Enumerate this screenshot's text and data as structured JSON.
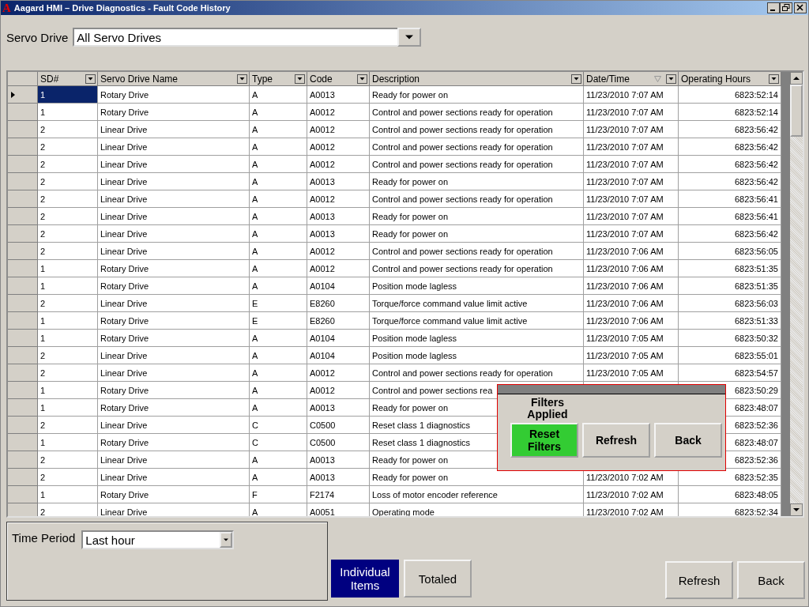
{
  "window": {
    "title": "Aagard HMI – Drive Diagnostics - Fault Code History",
    "logo": "A"
  },
  "servo_drive": {
    "label": "Servo Drive",
    "value": "All Servo Drives"
  },
  "table": {
    "columns": [
      {
        "label": "SD#",
        "sorted": false
      },
      {
        "label": "Servo Drive Name",
        "sorted": false
      },
      {
        "label": "Type",
        "sorted": false
      },
      {
        "label": "Code",
        "sorted": false
      },
      {
        "label": "Description",
        "sorted": false
      },
      {
        "label": "Date/Time",
        "sorted": true
      },
      {
        "label": "Operating Hours",
        "sorted": false
      }
    ],
    "rows": [
      {
        "selected": true,
        "sd": "1",
        "name": "Rotary Drive",
        "type": "A",
        "code": "A0013",
        "description": "Ready for power on",
        "datetime": "11/23/2010 7:07 AM",
        "hours": "6823:52:14"
      },
      {
        "selected": false,
        "sd": "1",
        "name": "Rotary Drive",
        "type": "A",
        "code": "A0012",
        "description": "Control and power sections ready for operation",
        "datetime": "11/23/2010 7:07 AM",
        "hours": "6823:52:14"
      },
      {
        "selected": false,
        "sd": "2",
        "name": "Linear Drive",
        "type": "A",
        "code": "A0012",
        "description": "Control and power sections ready for operation",
        "datetime": "11/23/2010 7:07 AM",
        "hours": "6823:56:42"
      },
      {
        "selected": false,
        "sd": "2",
        "name": "Linear Drive",
        "type": "A",
        "code": "A0012",
        "description": "Control and power sections ready for operation",
        "datetime": "11/23/2010 7:07 AM",
        "hours": "6823:56:42"
      },
      {
        "selected": false,
        "sd": "2",
        "name": "Linear Drive",
        "type": "A",
        "code": "A0012",
        "description": "Control and power sections ready for operation",
        "datetime": "11/23/2010 7:07 AM",
        "hours": "6823:56:42"
      },
      {
        "selected": false,
        "sd": "2",
        "name": "Linear Drive",
        "type": "A",
        "code": "A0013",
        "description": "Ready for power on",
        "datetime": "11/23/2010 7:07 AM",
        "hours": "6823:56:42"
      },
      {
        "selected": false,
        "sd": "2",
        "name": "Linear Drive",
        "type": "A",
        "code": "A0012",
        "description": "Control and power sections ready for operation",
        "datetime": "11/23/2010 7:07 AM",
        "hours": "6823:56:41"
      },
      {
        "selected": false,
        "sd": "2",
        "name": "Linear Drive",
        "type": "A",
        "code": "A0013",
        "description": "Ready for power on",
        "datetime": "11/23/2010 7:07 AM",
        "hours": "6823:56:41"
      },
      {
        "selected": false,
        "sd": "2",
        "name": "Linear Drive",
        "type": "A",
        "code": "A0013",
        "description": "Ready for power on",
        "datetime": "11/23/2010 7:07 AM",
        "hours": "6823:56:42"
      },
      {
        "selected": false,
        "sd": "2",
        "name": "Linear Drive",
        "type": "A",
        "code": "A0012",
        "description": "Control and power sections ready for operation",
        "datetime": "11/23/2010 7:06 AM",
        "hours": "6823:56:05"
      },
      {
        "selected": false,
        "sd": "1",
        "name": "Rotary Drive",
        "type": "A",
        "code": "A0012",
        "description": "Control and power sections ready for operation",
        "datetime": "11/23/2010 7:06 AM",
        "hours": "6823:51:35"
      },
      {
        "selected": false,
        "sd": "1",
        "name": "Rotary Drive",
        "type": "A",
        "code": "A0104",
        "description": "Position mode lagless",
        "datetime": "11/23/2010 7:06 AM",
        "hours": "6823:51:35"
      },
      {
        "selected": false,
        "sd": "2",
        "name": "Linear Drive",
        "type": "E",
        "code": "E8260",
        "description": "Torque/force command value limit active",
        "datetime": "11/23/2010 7:06 AM",
        "hours": "6823:56:03"
      },
      {
        "selected": false,
        "sd": "1",
        "name": "Rotary Drive",
        "type": "E",
        "code": "E8260",
        "description": "Torque/force command value limit active",
        "datetime": "11/23/2010 7:06 AM",
        "hours": "6823:51:33"
      },
      {
        "selected": false,
        "sd": "1",
        "name": "Rotary Drive",
        "type": "A",
        "code": "A0104",
        "description": "Position mode lagless",
        "datetime": "11/23/2010 7:05 AM",
        "hours": "6823:50:32"
      },
      {
        "selected": false,
        "sd": "2",
        "name": "Linear Drive",
        "type": "A",
        "code": "A0104",
        "description": "Position mode lagless",
        "datetime": "11/23/2010 7:05 AM",
        "hours": "6823:55:01"
      },
      {
        "selected": false,
        "sd": "2",
        "name": "Linear Drive",
        "type": "A",
        "code": "A0012",
        "description": "Control and power sections ready for operation",
        "datetime": "11/23/2010 7:05 AM",
        "hours": "6823:54:57"
      },
      {
        "selected": false,
        "sd": "1",
        "name": "Rotary Drive",
        "type": "A",
        "code": "A0012",
        "description": "Control and power sections rea",
        "hours": "6823:50:29"
      },
      {
        "selected": false,
        "sd": "1",
        "name": "Rotary Drive",
        "type": "A",
        "code": "A0013",
        "description": "Ready for power on",
        "hours": "6823:48:07"
      },
      {
        "selected": false,
        "sd": "2",
        "name": "Linear Drive",
        "type": "C",
        "code": "C0500",
        "description": "Reset class 1 diagnostics",
        "hours": "6823:52:36"
      },
      {
        "selected": false,
        "sd": "1",
        "name": "Rotary Drive",
        "type": "C",
        "code": "C0500",
        "description": "Reset class 1 diagnostics",
        "hours": "6823:48:07"
      },
      {
        "selected": false,
        "sd": "2",
        "name": "Linear Drive",
        "type": "A",
        "code": "A0013",
        "description": "Ready for power on",
        "hours": "6823:52:36"
      },
      {
        "selected": false,
        "sd": "2",
        "name": "Linear Drive",
        "type": "A",
        "code": "A0013",
        "description": "Ready for power on",
        "datetime": "11/23/2010 7:02 AM",
        "hours": "6823:52:35"
      },
      {
        "selected": false,
        "sd": "1",
        "name": "Rotary Drive",
        "type": "F",
        "code": "F2174",
        "description": "Loss of motor encoder reference",
        "datetime": "11/23/2010 7:02 AM",
        "hours": "6823:48:05"
      },
      {
        "selected": false,
        "sd": "2",
        "name": "Linear Drive",
        "type": "A",
        "code": "A0051",
        "description": "Operating mode",
        "datetime": "11/23/2010 7:02 AM",
        "hours": "6823:52:34"
      }
    ]
  },
  "popup": {
    "message": "Filters Applied",
    "buttons": [
      {
        "label": "Reset Filters",
        "kind": "primary"
      },
      {
        "label": "Refresh",
        "kind": "normal"
      },
      {
        "label": "Back",
        "kind": "normal"
      }
    ]
  },
  "time_period": {
    "label": "Time Period",
    "value": "Last hour"
  },
  "view_tabs": [
    {
      "label": "Individual Items",
      "selected": true
    },
    {
      "label": "Totaled",
      "selected": false
    }
  ],
  "buttons": [
    "Refresh",
    "Back"
  ]
}
